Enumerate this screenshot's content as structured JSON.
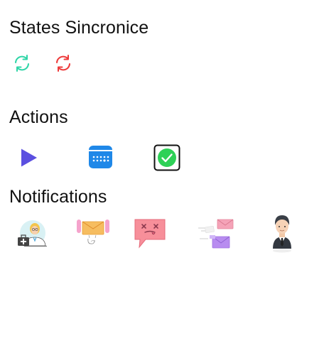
{
  "sections": {
    "states": {
      "title": "States Sincronice",
      "icons": [
        {
          "name": "sync-ok-icon",
          "color": "#2fd5a7"
        },
        {
          "name": "sync-error-icon",
          "color": "#ee3a3a"
        }
      ]
    },
    "actions": {
      "title": "Actions",
      "icons": [
        {
          "name": "play-icon",
          "color": "#5b4fe0"
        },
        {
          "name": "calendar-icon",
          "color": "#1f88e8"
        },
        {
          "name": "checkbox-checked-icon",
          "color": "#2ed157"
        }
      ]
    },
    "notifications": {
      "title": "Notifications",
      "icons": [
        {
          "name": "doctor-icon"
        },
        {
          "name": "mail-hands-icon"
        },
        {
          "name": "error-chat-bubble-icon",
          "color": "#f78f9a"
        },
        {
          "name": "flying-mail-icon"
        },
        {
          "name": "businessman-icon"
        }
      ]
    }
  }
}
